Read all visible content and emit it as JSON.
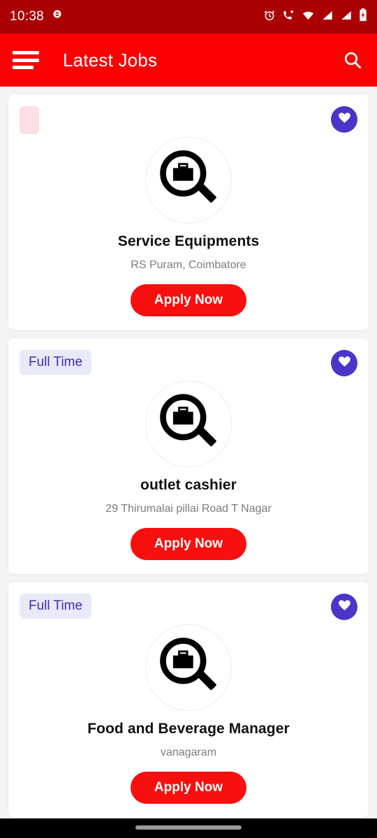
{
  "status_bar": {
    "time": "10:38",
    "icons": [
      "gear-icon",
      "alarm-icon",
      "call-wifi-icon",
      "wifi-icon",
      "signal-icon",
      "signal-icon-2",
      "battery-icon"
    ],
    "background_color": "#aa0000",
    "foreground_color": "#ffffff"
  },
  "app_bar": {
    "title": "Latest Jobs",
    "menu_icon": "hamburger-icon",
    "search_icon": "search-icon",
    "background_color": "#fb0000",
    "title_color": "#ffffff"
  },
  "theme": {
    "page_background": "#f4f4f4",
    "card_background": "#ffffff",
    "accent_red": "#f80f0f",
    "badge_background": "#e8eaf8",
    "badge_text": "#3b2fa8",
    "favorite_circle": "#4a35c9",
    "title_color": "#111111",
    "location_color": "#7c7c7c"
  },
  "jobs": [
    {
      "badge": "",
      "badge_empty": true,
      "thumb_icon": "job-search-briefcase-icon",
      "title": "Service Equipments",
      "location": "RS Puram, Coimbatore",
      "apply_label": "Apply Now",
      "favorite_icon": "heart-icon",
      "favorited": true
    },
    {
      "badge": "Full Time",
      "badge_empty": false,
      "thumb_icon": "job-search-briefcase-icon",
      "title": "outlet cashier",
      "location": "29 Thirumalai pillai Road T Nagar",
      "apply_label": "Apply Now",
      "favorite_icon": "heart-icon",
      "favorited": true
    },
    {
      "badge": "Full Time",
      "badge_empty": false,
      "thumb_icon": "job-search-briefcase-icon",
      "title": "Food and Beverage Manager",
      "location": "vanagaram",
      "apply_label": "Apply Now",
      "favorite_icon": "heart-icon",
      "favorited": true
    }
  ],
  "nav_bar": {
    "gesture_handle": "home-gesture-pill",
    "background_color": "#000000"
  }
}
